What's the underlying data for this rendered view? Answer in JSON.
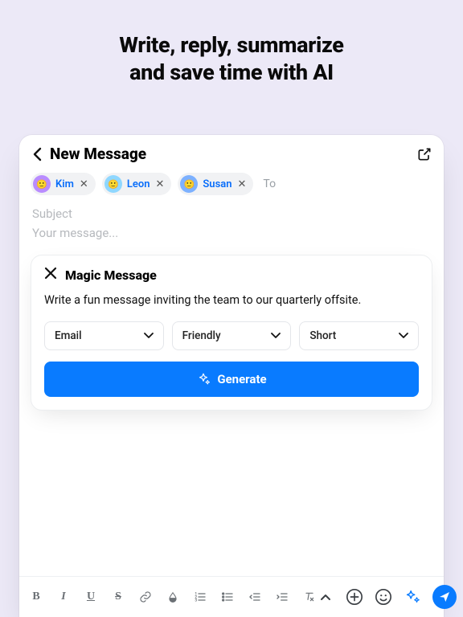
{
  "hero": {
    "line1": "Write, reply, summarize",
    "line2": "and save time with AI"
  },
  "window": {
    "title": "New Message",
    "to_label": "To"
  },
  "recipients": [
    {
      "name": "Kim",
      "avatar_bg": "#b98cff"
    },
    {
      "name": "Leon",
      "avatar_bg": "#8fd7ff"
    },
    {
      "name": "Susan",
      "avatar_bg": "#7db1ff"
    }
  ],
  "compose": {
    "subject_placeholder": "Subject",
    "body_placeholder": "Your message..."
  },
  "magic": {
    "title": "Magic Message",
    "prompt": "Write a fun message inviting the team to our quarterly offsite.",
    "selects": {
      "type": "Email",
      "tone": "Friendly",
      "length": "Short"
    },
    "generate_label": "Generate"
  },
  "colors": {
    "accent": "#097bff"
  }
}
